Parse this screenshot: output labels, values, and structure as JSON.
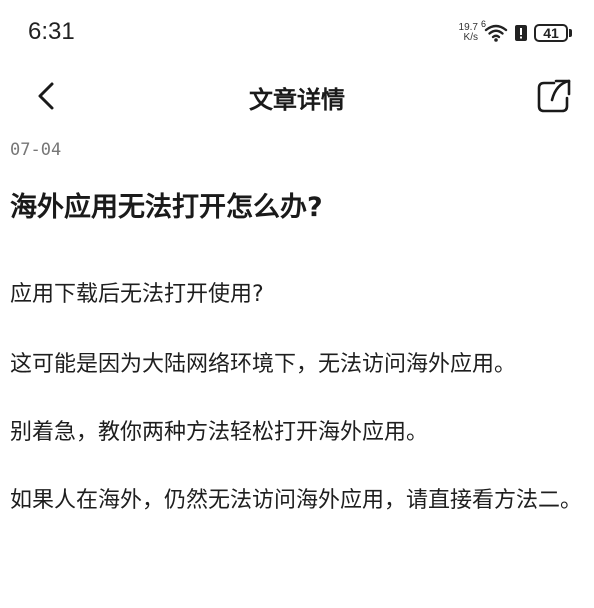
{
  "status_bar": {
    "time": "6:31",
    "net_speed_value": "19.7",
    "net_speed_unit": "K/s",
    "signal_label": "6",
    "battery_level": "41"
  },
  "header": {
    "title": "文章详情"
  },
  "article": {
    "date": "07-04",
    "title": "海外应用无法打开怎么办?",
    "paragraphs": [
      "应用下载后无法打开使用?",
      "这可能是因为大陆网络环境下，无法访问海外应用。",
      "别着急，教你两种方法轻松打开海外应用。",
      "如果人在海外，仍然无法访问海外应用，请直接看方法二。"
    ]
  }
}
